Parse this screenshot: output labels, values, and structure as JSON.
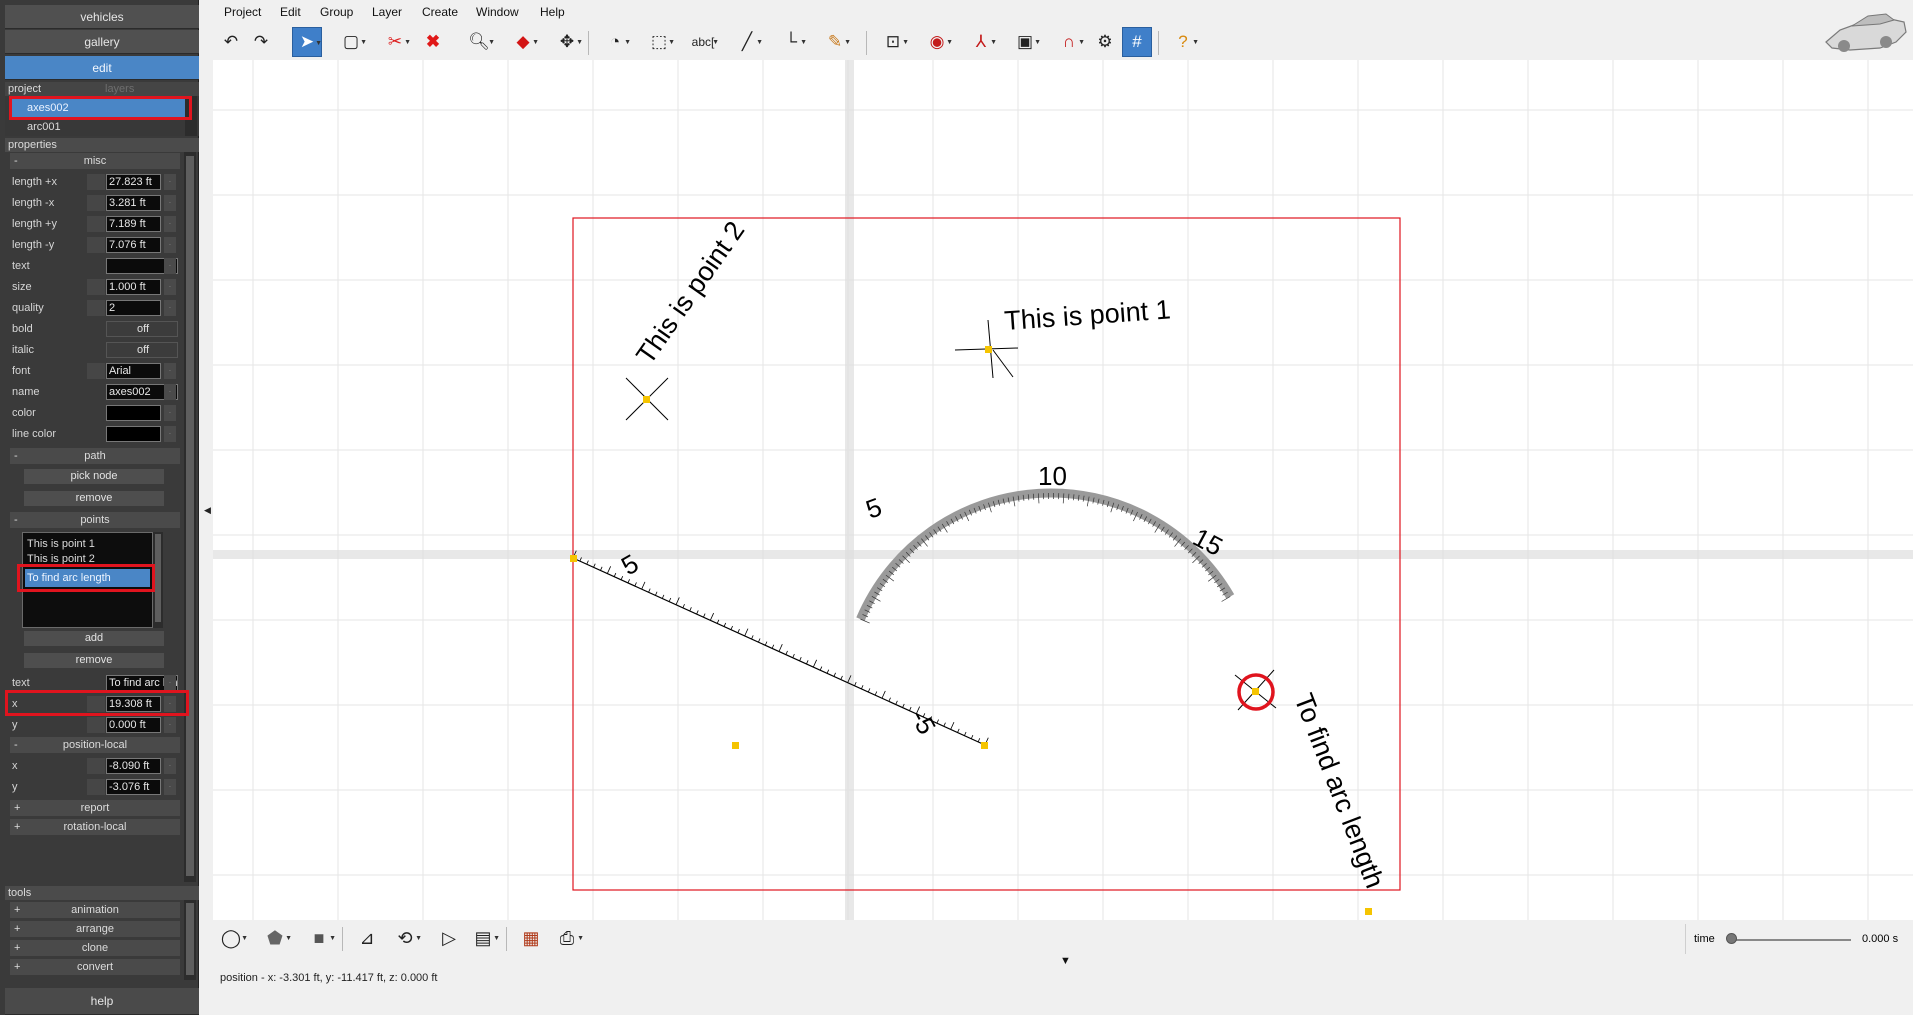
{
  "left_panel": {
    "nav": {
      "vehicles": "vehicles",
      "gallery": "gallery",
      "edit": "edit"
    },
    "tabs": {
      "project": "project",
      "layers": "layers"
    },
    "tree": [
      {
        "label": "axes002",
        "selected": true
      },
      {
        "label": "arc001",
        "selected": false
      }
    ],
    "properties_header": "properties",
    "misc_section": {
      "toggle": "-",
      "title": "misc"
    },
    "misc_props": [
      {
        "label": "length +x",
        "value": "27.823 ft"
      },
      {
        "label": "length -x",
        "value": "3.281 ft"
      },
      {
        "label": "length +y",
        "value": "7.189 ft"
      },
      {
        "label": "length -y",
        "value": "7.076 ft"
      },
      {
        "label": "text",
        "value": ""
      },
      {
        "label": "size",
        "value": "1.000 ft"
      },
      {
        "label": "quality",
        "value": "2"
      },
      {
        "label": "bold",
        "value": "off"
      },
      {
        "label": "italic",
        "value": "off"
      },
      {
        "label": "font",
        "value": "Arial"
      },
      {
        "label": "name",
        "value": "axes002"
      },
      {
        "label": "color",
        "value": ""
      },
      {
        "label": "line color",
        "value": ""
      }
    ],
    "path_section": {
      "toggle": "-",
      "title": "path",
      "pick_node": "pick node",
      "remove": "remove"
    },
    "points_section": {
      "toggle": "-",
      "title": "points",
      "items": [
        "This is point 1",
        "This is point 2",
        "To find arc length"
      ],
      "selected_index": 2,
      "add": "add",
      "remove": "remove"
    },
    "point_props": [
      {
        "label": "text",
        "value": "To find arc length"
      },
      {
        "label": "x",
        "value": "19.308 ft"
      },
      {
        "label": "y",
        "value": "0.000 ft"
      }
    ],
    "position_local": {
      "toggle": "-",
      "title": "position-local",
      "props": [
        {
          "label": "x",
          "value": "-8.090 ft"
        },
        {
          "label": "y",
          "value": "-3.076 ft"
        }
      ]
    },
    "report": {
      "toggle": "+",
      "title": "report"
    },
    "rotation_local": {
      "toggle": "+",
      "title": "rotation-local"
    },
    "tools_header": "tools",
    "tools": [
      {
        "toggle": "+",
        "title": "animation"
      },
      {
        "toggle": "+",
        "title": "arrange"
      },
      {
        "toggle": "+",
        "title": "clone"
      },
      {
        "toggle": "+",
        "title": "convert"
      }
    ],
    "help": "help"
  },
  "menu": [
    "Project",
    "Edit",
    "Group",
    "Layer",
    "Create",
    "Window",
    "Help"
  ],
  "toolbar": {
    "icons": [
      "undo-icon",
      "redo-icon",
      "select-pointer-icon",
      "rectangle-select-icon",
      "cut-icon",
      "delete-icon",
      "zoom-icon",
      "solid-box-icon",
      "move-icon",
      "measure-icon",
      "paper-icon",
      "text-icon",
      "line-icon",
      "axes-icon",
      "pencil-icon",
      "target-box-icon",
      "target-icon",
      "coordinate-icon",
      "image-icon",
      "magnet-icon",
      "gear-icon",
      "grid-icon",
      "help-icon"
    ],
    "text_tool_label": "abc"
  },
  "canvas": {
    "labels": {
      "point1": "This is point 1",
      "point2": "This is point 2",
      "arc_length": "To find arc length"
    },
    "axis_ticks": {
      "line_5": "5",
      "line_neg5": "-5",
      "arc_5": "5",
      "arc_10": "10",
      "arc_15": "15"
    },
    "colors": {
      "bounding_box": "#e0141e",
      "handle": "#f5c400",
      "arc": "#9a9a9a",
      "grid": "#e6e6e6"
    }
  },
  "bottom": {
    "icons": [
      "circle-icon",
      "shield-shape-icon",
      "fill-box-icon",
      "graph-icon",
      "transform-icon",
      "play-icon",
      "step-icon",
      "layout-icon",
      "print-icon"
    ],
    "time_label": "time",
    "time_value": "0.000 s",
    "time_fraction": 0.0
  },
  "status": {
    "position": "position - x: -3.301 ft, y: -11.417 ft, z: 0.000 ft"
  }
}
